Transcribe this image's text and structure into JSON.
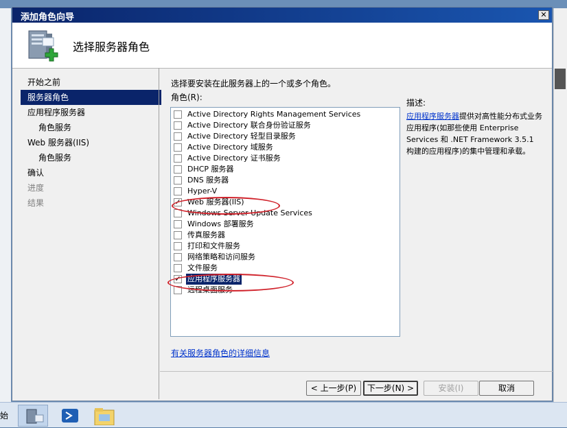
{
  "dialog": {
    "title": "添加角色向导",
    "close_glyph": "✕",
    "page_title": "选择服务器角色"
  },
  "nav": {
    "items": [
      {
        "label": "开始之前",
        "state": "normal",
        "level": 0
      },
      {
        "label": "服务器角色",
        "state": "selected",
        "level": 0
      },
      {
        "label": "应用程序服务器",
        "state": "normal",
        "level": 0
      },
      {
        "label": "角色服务",
        "state": "normal",
        "level": 1
      },
      {
        "label": "Web 服务器(IIS)",
        "state": "normal",
        "level": 0
      },
      {
        "label": "角色服务",
        "state": "normal",
        "level": 1
      },
      {
        "label": "确认",
        "state": "normal",
        "level": 0
      },
      {
        "label": "进度",
        "state": "disabled",
        "level": 0
      },
      {
        "label": "结果",
        "state": "disabled",
        "level": 0
      }
    ]
  },
  "content": {
    "instruction": "选择要安装在此服务器上的一个或多个角色。",
    "roles_label": "角色(R):",
    "roles": [
      {
        "label": "Active Directory Rights Management Services",
        "checked": false
      },
      {
        "label": "Active Directory 联合身份验证服务",
        "checked": false
      },
      {
        "label": "Active Directory 轻型目录服务",
        "checked": false
      },
      {
        "label": "Active Directory 域服务",
        "checked": false
      },
      {
        "label": "Active Directory 证书服务",
        "checked": false
      },
      {
        "label": "DHCP 服务器",
        "checked": false
      },
      {
        "label": "DNS 服务器",
        "checked": false
      },
      {
        "label": "Hyper-V",
        "checked": false
      },
      {
        "label": "Web 服务器(IIS)",
        "checked": true
      },
      {
        "label": "Windows Server Update Services",
        "checked": false
      },
      {
        "label": "Windows 部署服务",
        "checked": false
      },
      {
        "label": "传真服务器",
        "checked": false
      },
      {
        "label": "打印和文件服务",
        "checked": false
      },
      {
        "label": "网络策略和访问服务",
        "checked": false
      },
      {
        "label": "文件服务",
        "checked": false
      },
      {
        "label": "应用程序服务器",
        "checked": true,
        "selected": true
      },
      {
        "label": "远程桌面服务",
        "checked": false
      }
    ],
    "details_link": "有关服务器角色的详细信息",
    "description_label": "描述:",
    "description_link": "应用程序服务器",
    "description_text": "提供对高性能分布式业务应用程序(如那些使用 Enterprise Services 和 .NET Framework 3.5.1 构建的应用程序)的集中管理和承载。"
  },
  "buttons": {
    "back": "< 上一步(P)",
    "next": "下一步(N) >",
    "install": "安装(I)",
    "cancel": "取消"
  },
  "taskbar": {
    "partial_text": "始"
  },
  "colors": {
    "titlebar": "#0a246a",
    "selection": "#0a246a",
    "annotation": "#d0212a",
    "link": "#0033cc"
  }
}
